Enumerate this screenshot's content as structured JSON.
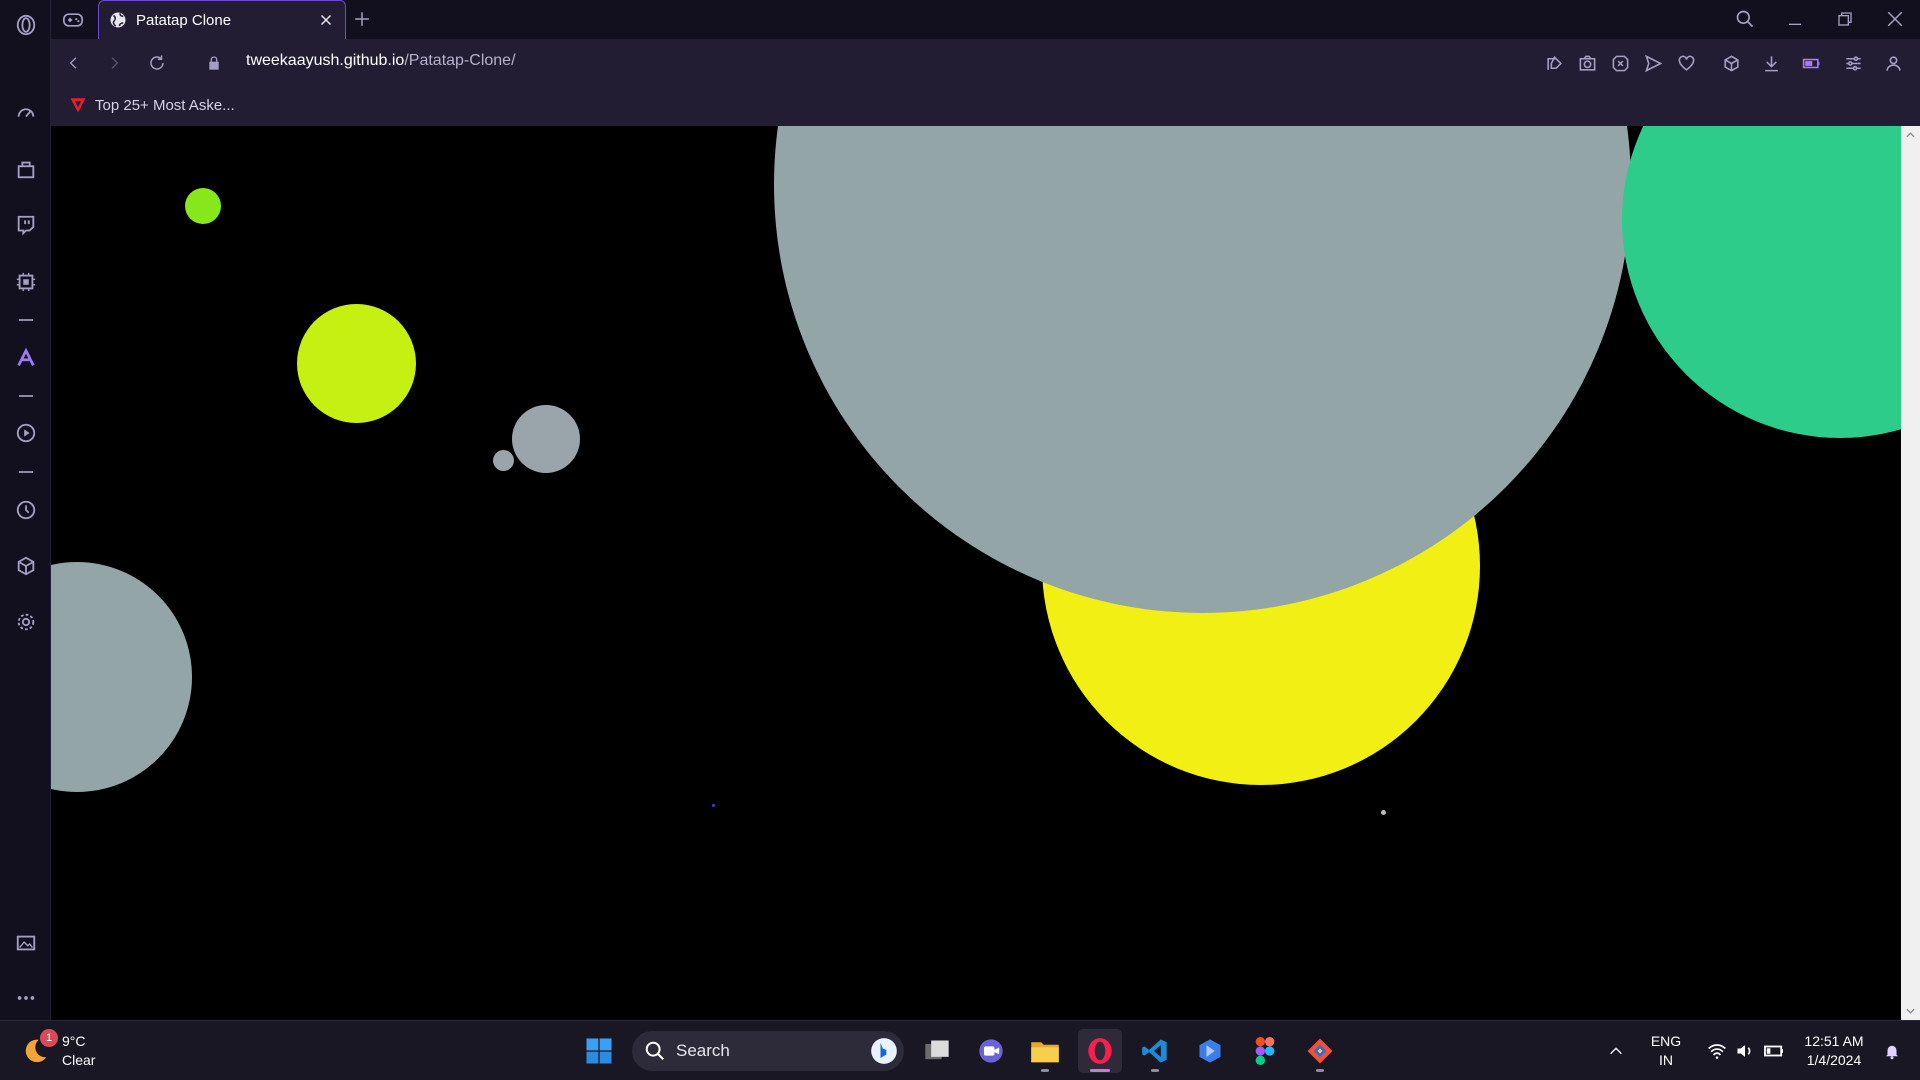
{
  "browser": {
    "tab": {
      "title": "Patatap Clone"
    },
    "address": {
      "host": "tweekaayush.github.io",
      "path": "/Patatap-Clone/"
    },
    "bookmarks": [
      {
        "label": "Top 25+ Most Aske..."
      }
    ]
  },
  "page": {
    "background": "#000000",
    "circles": [
      {
        "color": "#93a5a6",
        "name": "large-gray-circle"
      },
      {
        "color": "#2ecc8a",
        "name": "green-circle"
      },
      {
        "color": "#f1ef13",
        "name": "yellow-circle"
      },
      {
        "color": "#c5f012",
        "name": "lime-circle"
      },
      {
        "color": "#86e81a",
        "name": "small-green-circle"
      },
      {
        "color": "#9aa4ab",
        "name": "small-gray-circle"
      },
      {
        "color": "#93a5a6",
        "name": "left-gray-circle"
      }
    ]
  },
  "taskbar": {
    "weather": {
      "temp": "9°C",
      "condition": "Clear",
      "badge": "1"
    },
    "search": {
      "placeholder": "Search"
    },
    "tray": {
      "lang": "ENG",
      "region": "IN",
      "time": "12:51 AM",
      "date": "1/4/2024"
    }
  }
}
